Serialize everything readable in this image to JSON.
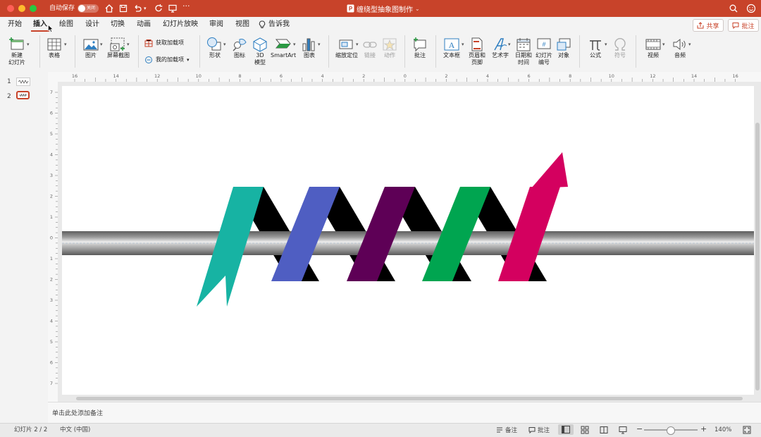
{
  "window": {
    "autosave_label": "自动保存",
    "autosave_state": "关闭",
    "document_title": "缠绕型抽象图制作",
    "traffic_colors": [
      "#ff5f57",
      "#febc2e",
      "#28c840"
    ],
    "accent_color": "#c8432a"
  },
  "tabs": [
    {
      "label": "开始"
    },
    {
      "label": "插入",
      "active": true
    },
    {
      "label": "绘图"
    },
    {
      "label": "设计"
    },
    {
      "label": "切换"
    },
    {
      "label": "动画"
    },
    {
      "label": "幻灯片放映"
    },
    {
      "label": "审阅"
    },
    {
      "label": "视图"
    },
    {
      "label": "告诉我"
    }
  ],
  "header_buttons": {
    "share": "共享",
    "comment": "批注"
  },
  "ribbon": {
    "new_slide_line1": "新建",
    "new_slide_line2": "幻灯片",
    "table": "表格",
    "picture": "图片",
    "screenshot": "屏幕截图",
    "get_addins": "获取加载项",
    "my_addins": "我的加载项",
    "shapes": "形状",
    "icons": "图标",
    "model3d_line1": "3D",
    "model3d_line2": "模型",
    "smartart": "SmartArt",
    "chart": "图表",
    "zoom_link": "缩放定位",
    "link": "链接",
    "action": "动作",
    "comment": "批注",
    "textbox": "文本框",
    "header_footer_line1": "页眉和",
    "header_footer_line2": "页脚",
    "wordart": "艺术字",
    "date_time_line1": "日期和",
    "date_time_line2": "时间",
    "slide_number_line1": "幻灯片",
    "slide_number_line2": "编号",
    "object": "对象",
    "equation": "公式",
    "symbol": "符号",
    "video": "视频",
    "audio": "音频"
  },
  "ruler": {
    "h_labels": [
      "16",
      "14",
      "12",
      "10",
      "8",
      "6",
      "4",
      "2",
      "0",
      "2",
      "4",
      "6",
      "8",
      "10",
      "12",
      "14",
      "16"
    ],
    "v_labels": [
      "7",
      "6",
      "5",
      "4",
      "3",
      "2",
      "1",
      "0",
      "1",
      "2",
      "3",
      "4",
      "5",
      "6",
      "7"
    ]
  },
  "slides": [
    {
      "number": "1"
    },
    {
      "number": "2",
      "selected": true
    }
  ],
  "notes_placeholder": "单击此处添加备注",
  "status": {
    "slide_indicator": "幻灯片 2 / 2",
    "language": "中文 (中国)",
    "notes_btn": "备注",
    "comments_btn": "批注",
    "zoom": "140%",
    "zoom_level": 0.5
  },
  "artwork": {
    "ribbon_colors": [
      "#17b3a3",
      "#4f5ec2",
      "#5e0056",
      "#00a550",
      "#d4005f"
    ],
    "back_color": "#000000",
    "rod_color": "#9a9a9a"
  }
}
